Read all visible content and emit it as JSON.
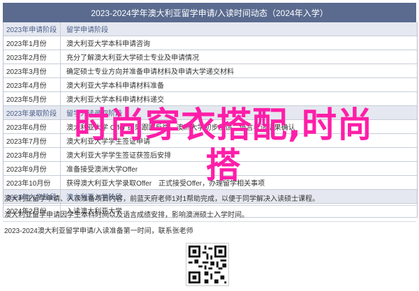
{
  "banner": {
    "title": "2023-2024学年澳大利亚留学申请/入读时间动态（2024年入学）"
  },
  "rows": [
    {
      "type": "section",
      "date": "2023年申请阶段",
      "text": "留学申请阶段"
    },
    {
      "type": "row",
      "date": "2023年1月份",
      "text": "澳大利亚大学本科申请咨询"
    },
    {
      "type": "row",
      "date": "2023年2月份",
      "text": "充分了解澳大利亚大学硕士专业及申请情况"
    },
    {
      "type": "row",
      "date": "2023年3月份",
      "text": "确定硕士专业方向并准备申请材料及申请大学递交材料"
    },
    {
      "type": "row",
      "date": "2023年4月份",
      "text": "澳大利亚大学本科申请材料准备"
    },
    {
      "type": "row",
      "date": "2023年5月份",
      "text": "澳大利亚大学本科申请材料递交"
    },
    {
      "type": "section",
      "date": "2023年录取阶段",
      "text": "留学入读录取阶段"
    },
    {
      "type": "row",
      "date": "2023年6月份",
      "text": "澳大利亚大学 Offer 结果跟踪反馈　澳洲大学初步反馈　语言考试结果确认"
    },
    {
      "type": "row",
      "date": "2023年7月份",
      "text": "澳大利亚大学学生签证申请"
    },
    {
      "type": "row",
      "date": "2023年8月份",
      "text": "澳大利亚大学学生签证获签后安排"
    },
    {
      "type": "row",
      "date": "2023年9月份",
      "text": "准备接受澳洲大学Offer"
    },
    {
      "type": "row",
      "date": "2023年10月份",
      "text": "获得澳大利亚大学录取Offer　正式接受Offer，办理留学相关事项"
    },
    {
      "type": "section",
      "date": "2023年入学阶段",
      "text": "澳大利亚入学阶段"
    },
    {
      "type": "row",
      "date": "2024年2月份",
      "text": "入读澳大利亚大学"
    }
  ],
  "overlay": {
    "text": "时尚穿衣搭配,时尚搭"
  },
  "footer": {
    "line1": "澳大利亚留学申请、入读准备项目内容，前蓝天府老师1对1帮助完成，以便于同学解决入读硕士课程。",
    "line2": "澳大利亚留学申请因学生本科时间以及语言成绩安排，影响澳洲硕士入学时间。",
    "line3": "2023-2024澳大利亚留学申请/入读准备第一时间，联系张老师"
  }
}
